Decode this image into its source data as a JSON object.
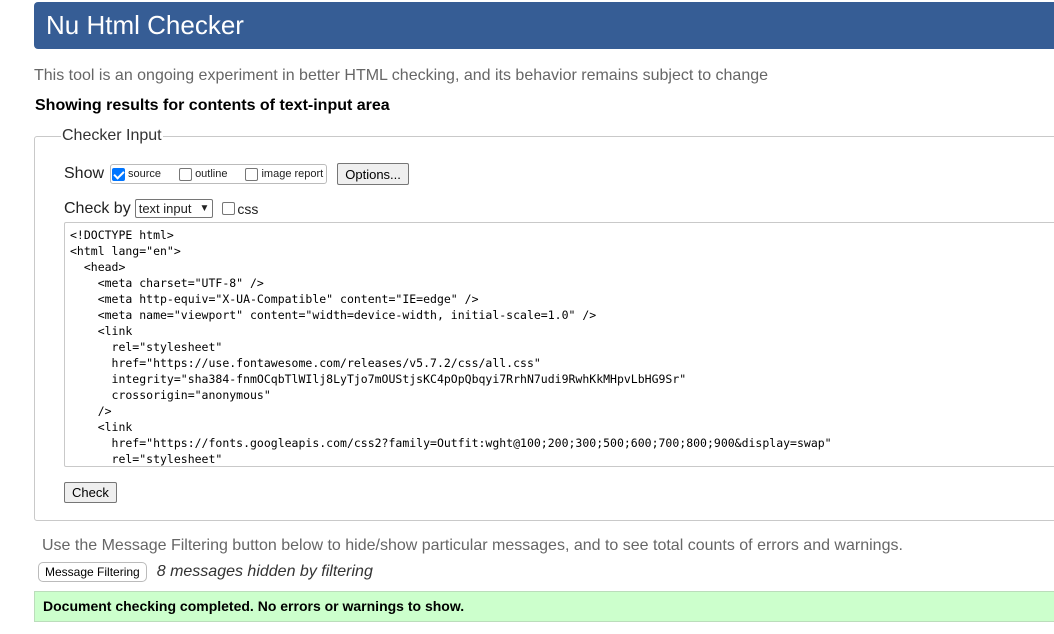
{
  "header": {
    "title": "Nu Html Checker"
  },
  "intro": "This tool is an ongoing experiment in better HTML checking, and its behavior remains subject to change",
  "results_heading": "Showing results for contents of text-input area",
  "checker": {
    "legend": "Checker Input",
    "show_label": "Show",
    "options": [
      {
        "label": "source",
        "checked": true
      },
      {
        "label": "outline",
        "checked": false
      },
      {
        "label": "image report",
        "checked": false
      }
    ],
    "options_button": "Options...",
    "check_by_label": "Check by",
    "check_by_value": "text input",
    "css_label": "css",
    "css_checked": false,
    "source_code": "<!DOCTYPE html>\n<html lang=\"en\">\n  <head>\n    <meta charset=\"UTF-8\" />\n    <meta http-equiv=\"X-UA-Compatible\" content=\"IE=edge\" />\n    <meta name=\"viewport\" content=\"width=device-width, initial-scale=1.0\" />\n    <link\n      rel=\"stylesheet\"\n      href=\"https://use.fontawesome.com/releases/v5.7.2/css/all.css\"\n      integrity=\"sha384-fnmOCqbTlWIlj8LyTjo7mOUStjsKC4pOpQbqyi7RrhN7udi9RwhKkMHpvLbHG9Sr\"\n      crossorigin=\"anonymous\"\n    />\n    <link\n      href=\"https://fonts.googleapis.com/css2?family=Outfit:wght@100;200;300;500;600;700;800;900&display=swap\"\n      rel=\"stylesheet\"",
    "check_button": "Check"
  },
  "filter": {
    "info": "Use the Message Filtering button below to hide/show particular messages, and to see total counts of errors and warnings.",
    "button": "Message Filtering",
    "hidden_count": "8 messages hidden by filtering"
  },
  "result": {
    "message": "Document checking completed. No errors or warnings to show."
  },
  "colors": {
    "header_bg": "#365d95",
    "success_bg": "#ccffcc",
    "checkbox_checked": "#0075ff"
  }
}
